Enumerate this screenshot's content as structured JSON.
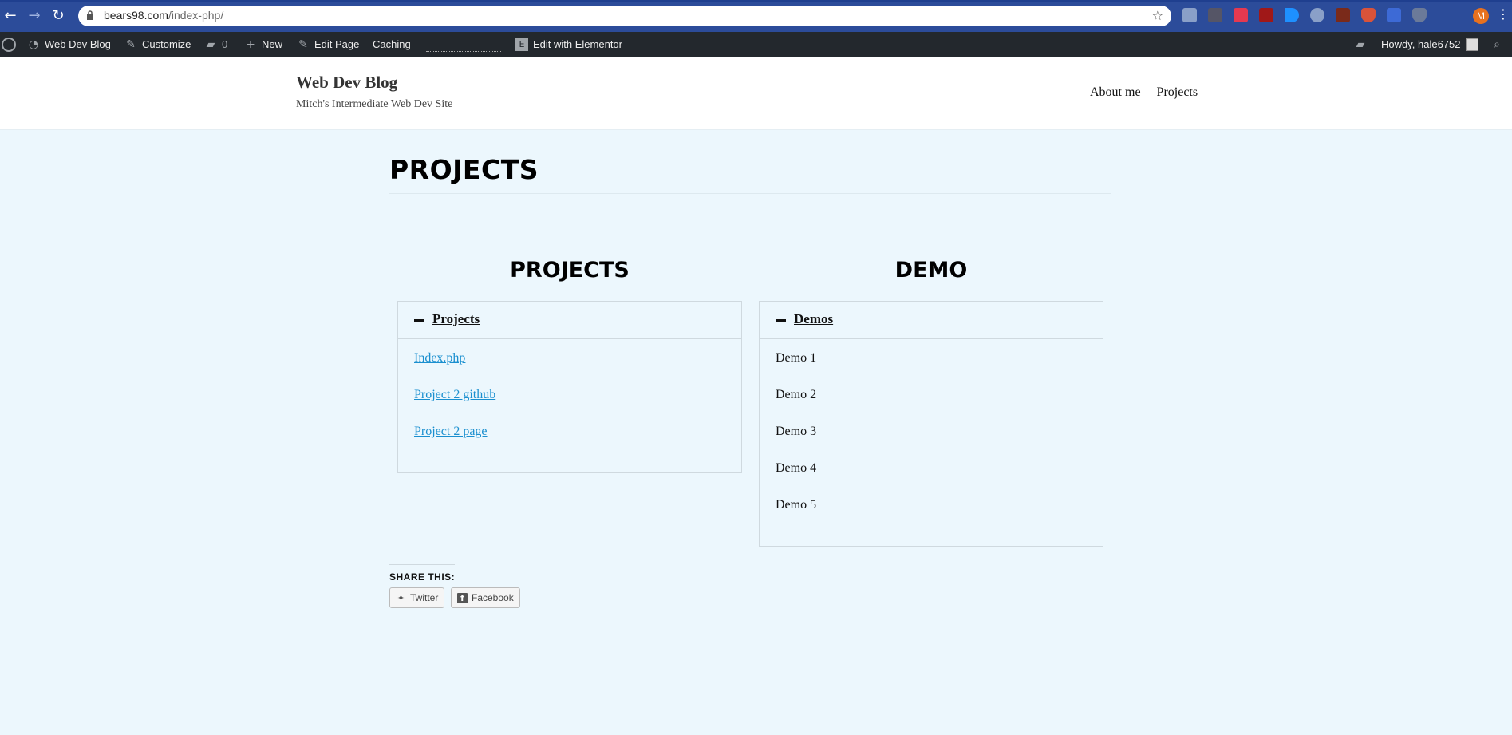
{
  "browser": {
    "url_host": "bears98.com",
    "url_path": "/index-php/",
    "profile_initial": "M"
  },
  "adminbar": {
    "site_name": "Web Dev Blog",
    "customize": "Customize",
    "comments_count": "0",
    "new": "New",
    "edit_page": "Edit Page",
    "caching": "Caching",
    "elementor": "Edit with Elementor",
    "howdy": "Howdy, hale6752"
  },
  "site": {
    "title": "Web Dev Blog",
    "description": "Mitch's Intermediate Web Dev Site",
    "nav": [
      "About me",
      "Projects"
    ]
  },
  "page": {
    "title": "PROJECTS",
    "columns": [
      {
        "heading": "PROJECTS",
        "accordion_title": "Projects",
        "items": [
          "Index.php",
          "Project 2 github",
          "Project 2 page"
        ]
      },
      {
        "heading": "DEMO",
        "accordion_title": "Demos",
        "items": [
          "Demo 1",
          "Demo 2",
          "Demo 3",
          "Demo 4",
          "Demo 5"
        ]
      }
    ],
    "share_label": "SHARE THIS:",
    "share_buttons": [
      "Twitter",
      "Facebook"
    ]
  },
  "colors": {
    "background": "#ecf7fd",
    "adminbar": "#23282d",
    "link": "#1a8fcf",
    "browser_bar": "#2c4c9a"
  }
}
